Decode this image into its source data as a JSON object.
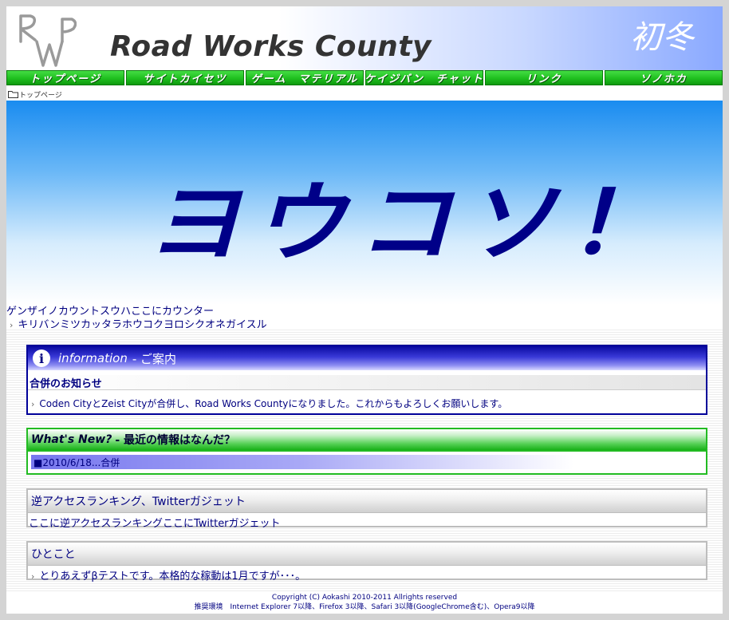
{
  "header": {
    "logo_text": "RWP",
    "title": "Road Works County",
    "season": "初冬"
  },
  "nav": {
    "items": [
      {
        "label": "トップページ"
      },
      {
        "label": "サイトカイセツ"
      },
      {
        "label": "ゲーム　マテリアル"
      },
      {
        "label": "ケイジバン　チャット"
      },
      {
        "label": "リンク"
      },
      {
        "label": "ソノホカ"
      }
    ]
  },
  "breadcrumb": {
    "label": "トップページ"
  },
  "banner": {
    "text": "ヨウコソ！"
  },
  "counter": {
    "line": "ゲンザイノカウントスウハここにカウンター",
    "kiriban": "キリバンミツカッタラホウコクヨロシクオネガイスル"
  },
  "information": {
    "title_en": "information",
    "title_ja": "- ご案内",
    "subheading": "合併のお知らせ",
    "body": "Coden CityとZeist Cityが合併し、Road Works Countyになりました。これからもよろしくお願いします。"
  },
  "whats_new": {
    "title_en": "What's New?",
    "title_ja": "- 最近の情報はなんだ？",
    "item": "■2010/6/18...合併"
  },
  "ranking": {
    "title": "逆アクセスランキング、Twitterガジェット",
    "body": "ここに逆アクセスランキングここにTwitterガジェット"
  },
  "hitokoto": {
    "title": "ひとこと",
    "body": "とりあえずβテストです。本格的な稼動は1月ですが･･･。"
  },
  "footer": {
    "copyright": "Copyright (C) Aokashi 2010-2011 Allrights reserved",
    "env": "推奨環境　Internet Explorer 7以降、Firefox 3以降、Safari 3以降(GoogleChrome含む)、Opera9以降"
  },
  "colors": {
    "accent": "#000080",
    "nav_green": "#22bb22",
    "banner_blue": "#1a8cf0"
  }
}
